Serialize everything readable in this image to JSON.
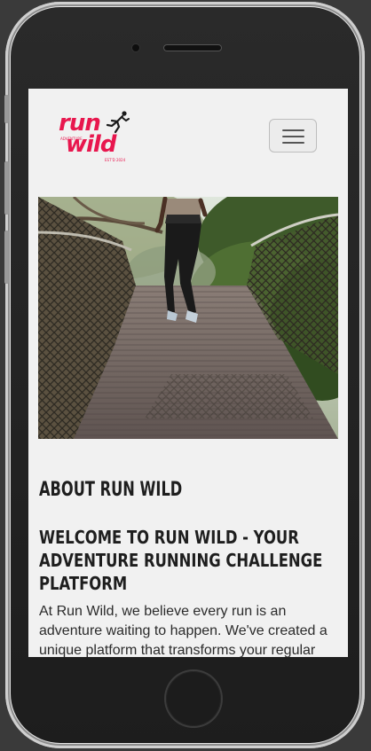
{
  "brand": {
    "logo_line1": "run",
    "logo_line2": "wild",
    "logo_tag_left": "ADVENTURE",
    "logo_tag_right": "EST'D 2024",
    "accent_color": "#e8174e"
  },
  "navbar": {
    "toggle_icon": "hamburger-icon"
  },
  "hero": {
    "subject": "runner-on-treetop-walkway"
  },
  "about": {
    "heading": "About Run Wild",
    "subheading": "Welcome to Run Wild - Your Adventure Running Challenge Platform",
    "paragraph": "At Run Wild, we believe every run is an adventure waiting to happen. We've created a unique platform that transforms your regular running"
  }
}
